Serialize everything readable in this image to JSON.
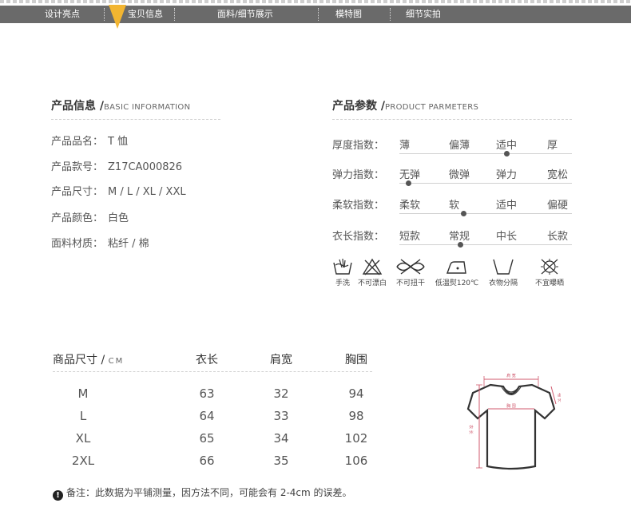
{
  "nav": {
    "items": [
      "设计亮点",
      "宝贝信息",
      "面料/细节展示",
      "模特图",
      "细节实拍"
    ],
    "active": "宝贝信息",
    "accent": "#f2b531"
  },
  "basic_info": {
    "title": "产品信息 /",
    "title_en": "BASIC INFORMATION",
    "rows": [
      {
        "label": "产品品名：",
        "value": "T 恤"
      },
      {
        "label": "产品款号：",
        "value": "Z17CA000826"
      },
      {
        "label": "产品尺寸：",
        "value": "M / L / XL / XXL"
      },
      {
        "label": "产品颜色：",
        "value": "白色"
      },
      {
        "label": "面料材质：",
        "value": "粘纤 / 棉"
      }
    ]
  },
  "params": {
    "title": "产品参数 /",
    "title_en": "PRODUCT PARMETERS",
    "rows": [
      {
        "label": "厚度指数：",
        "options": [
          "薄",
          "偏薄",
          "适中",
          "厚"
        ],
        "level": 0.62
      },
      {
        "label": "弹力指数：",
        "options": [
          "无弹",
          "微弹",
          "弹力",
          "宽松"
        ],
        "level": 0.05
      },
      {
        "label": "柔软指数：",
        "options": [
          "柔软",
          "软",
          "适中",
          "偏硬"
        ],
        "level": 0.37
      },
      {
        "label": "衣长指数：",
        "options": [
          "短款",
          "常规",
          "中长",
          "长款"
        ],
        "level": 0.35
      }
    ]
  },
  "care": {
    "items": [
      {
        "icon": "hand-wash-icon",
        "label": "手洗"
      },
      {
        "icon": "no-bleach-icon",
        "label": "不可漂白"
      },
      {
        "icon": "no-wring-icon",
        "label": "不可扭干"
      },
      {
        "icon": "low-iron-icon",
        "label": "低温熨120℃"
      },
      {
        "icon": "shade-dry-icon",
        "label": "衣物分隔"
      },
      {
        "icon": "no-tumble-dry-icon",
        "label": "不宜曝晒"
      }
    ]
  },
  "size_table": {
    "title": "商品尺寸 /",
    "unit": "CM",
    "columns": [
      "衣长",
      "肩宽",
      "胸围"
    ],
    "rows": [
      {
        "size": "M",
        "values": [
          "63",
          "32",
          "94"
        ]
      },
      {
        "size": "L",
        "values": [
          "64",
          "33",
          "98"
        ]
      },
      {
        "size": "XL",
        "values": [
          "65",
          "34",
          "102"
        ]
      },
      {
        "size": "2XL",
        "values": [
          "66",
          "35",
          "106"
        ]
      }
    ]
  },
  "diagram": {
    "shoulder": "肩 宽",
    "chest": "胸 围",
    "length": "衣 长",
    "sleeve": "袖 长",
    "color": "#d05a6e"
  },
  "note": {
    "text": "备注：此数据为平铺测量，因方法不同，可能会有 2-4cm 的误差。"
  }
}
